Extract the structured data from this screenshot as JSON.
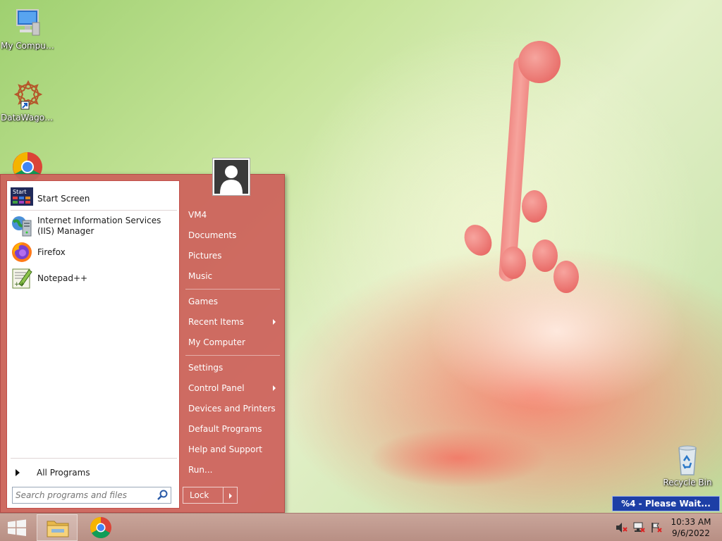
{
  "desktop": {
    "icons": [
      {
        "label": "My Computer",
        "icon": "computer-icon"
      },
      {
        "label": "DataWagon...",
        "icon": "datawagon-shortcut-icon"
      },
      {
        "label": "",
        "icon": "chrome-icon"
      },
      {
        "label": "Recycle Bin",
        "icon": "recycle-bin-icon"
      }
    ]
  },
  "start_menu": {
    "programs": [
      {
        "label": "Start Screen",
        "icon": "start-screen-icon"
      },
      {
        "label_line1": "Internet Information Services",
        "label_line2": "(IIS) Manager",
        "icon": "iis-manager-icon"
      },
      {
        "label": "Firefox",
        "icon": "firefox-icon"
      },
      {
        "label": "Notepad++",
        "icon": "notepadpp-icon"
      }
    ],
    "all_programs": "All Programs",
    "search_placeholder": "Search programs and files",
    "right": {
      "user": "VM4",
      "documents": "Documents",
      "pictures": "Pictures",
      "music": "Music",
      "games": "Games",
      "recent_items": "Recent Items",
      "my_computer": "My Computer",
      "settings": "Settings",
      "control_panel": "Control Panel",
      "devices_printers": "Devices and Printers",
      "default_programs": "Default Programs",
      "help_support": "Help and Support",
      "run": "Run..."
    },
    "lock_label": "Lock"
  },
  "notification": {
    "text": "%4 - Please Wait..."
  },
  "taskbar": {
    "items": [
      "start-button",
      "file-explorer",
      "chrome"
    ],
    "clock_time": "10:33 AM",
    "clock_date": "9/6/2022"
  },
  "colors": {
    "start_menu_bg": "#cd5f5a",
    "taskbar_bg": "#c09a8f",
    "notify_bg": "#1d3fa6"
  }
}
